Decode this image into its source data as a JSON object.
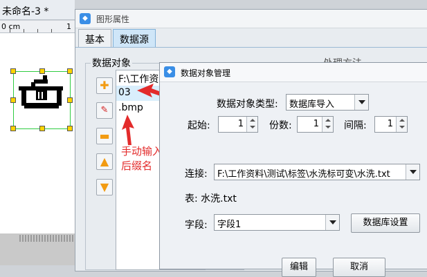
{
  "editor": {
    "tab_title": "未命名-3 *",
    "ruler_unit": "0 cm",
    "ruler_mark": "1"
  },
  "props_dialog": {
    "title": "图形属性",
    "tabs": [
      "基本",
      "数据源"
    ],
    "active_tab": "数据源",
    "group_label": "数据对象",
    "right_group_label": "处理方法",
    "objects": [
      "F:\\工作资料\\测试\\标签\\水洗标可变",
      "03",
      ".bmp"
    ],
    "side_buttons": [
      "plus-icon",
      "edit-icon",
      "minus-icon",
      "up-arrow-icon",
      "down-arrow-icon"
    ]
  },
  "annotation": {
    "line1": "手动输入",
    "line2": "后缀名",
    "color": "#e32b2b"
  },
  "mgr_dialog": {
    "title": "数据对象管理",
    "type_label": "数据对象类型:",
    "type_value": "数据库导入",
    "start_label": "起始:",
    "start_value": "1",
    "copies_label": "份数:",
    "copies_value": "1",
    "interval_label": "间隔:",
    "interval_value": "1",
    "conn_label": "连接:",
    "conn_value": "F:\\工作资料\\测试\\标签\\水洗标可变\\水洗.txt",
    "table_text": "表: 水洗.txt",
    "field_label": "字段:",
    "field_value": "字段1",
    "db_settings_button": "数据库设置",
    "edit_button": "编辑",
    "cancel_button": "取消"
  }
}
